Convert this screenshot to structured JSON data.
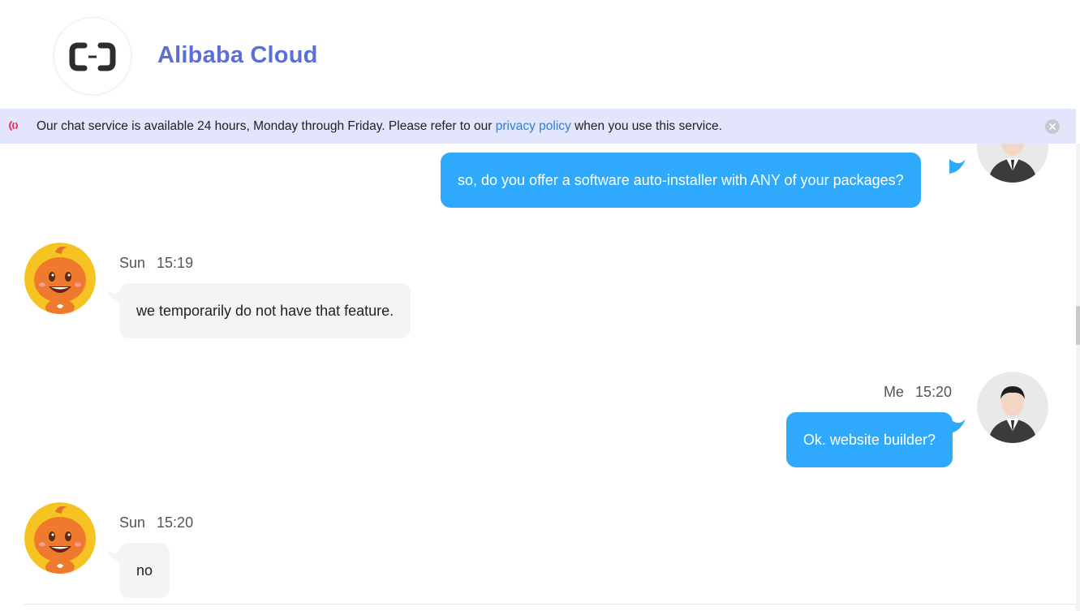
{
  "header": {
    "brand_name": "Alibaba Cloud",
    "logo_icon": "alibaba-cloud-logo-icon"
  },
  "notice": {
    "icon": "broadcast-icon",
    "text_before": "Our chat service is available 24 hours, Monday through Friday. Please refer to our ",
    "link_text": "privacy policy",
    "text_after": " when you use this service.",
    "close_icon": "close-icon"
  },
  "messages": [
    {
      "sender": "",
      "time": "",
      "text": "so, do you offer a software auto-installer with ANY of your packages?",
      "from_me": true
    },
    {
      "sender": "Sun",
      "time": "15:19",
      "text": "we temporarily do not have that feature.",
      "from_me": false
    },
    {
      "sender": "Me",
      "time": "15:20",
      "text": "Ok. website builder?",
      "from_me": true
    },
    {
      "sender": "Sun",
      "time": "15:20",
      "text": "no",
      "from_me": false
    }
  ],
  "colors": {
    "brand": "#5b6fd6",
    "my_bubble": "#2fa9fb",
    "their_bubble": "#f4f4f4",
    "notice_bg": "#e2e5fb",
    "link": "#2e7ed6"
  }
}
